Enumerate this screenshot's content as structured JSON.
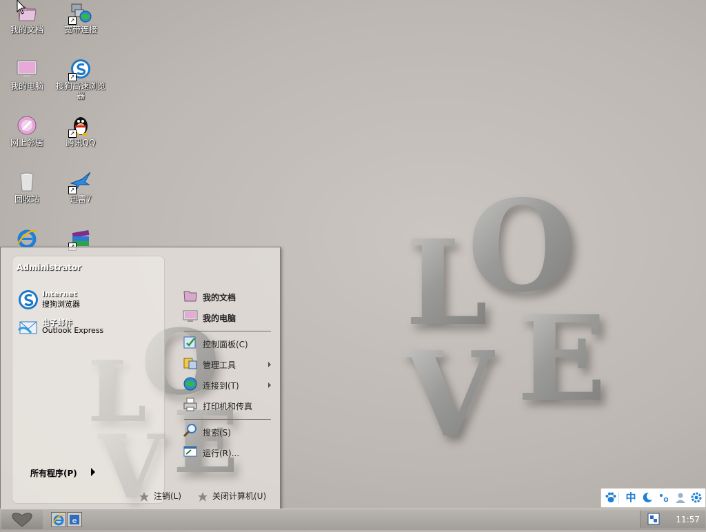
{
  "wallpaper": {
    "art": "love-sculpture",
    "letters": [
      "L",
      "O",
      "V",
      "E"
    ]
  },
  "desktop_icons": [
    {
      "label": "我的文档",
      "icon": "my-documents-icon",
      "shortcut": false
    },
    {
      "label": "宽带连接",
      "icon": "broadband-connection-icon",
      "shortcut": true
    },
    {
      "label": "我的电脑",
      "icon": "my-computer-icon",
      "shortcut": false
    },
    {
      "label": "搜狗高速浏览器",
      "icon": "sogou-browser-icon",
      "shortcut": true
    },
    {
      "label": "网上邻居",
      "icon": "network-places-icon",
      "shortcut": false
    },
    {
      "label": "腾讯QQ",
      "icon": "qq-penguin-icon",
      "shortcut": true
    },
    {
      "label": "回收站",
      "icon": "recycle-bin-icon",
      "shortcut": false
    },
    {
      "label": "迅雷7",
      "icon": "xunlei-bird-icon",
      "shortcut": true
    },
    {
      "label": "",
      "icon": "internet-explorer-icon",
      "shortcut": false
    },
    {
      "label": "",
      "icon": "winrar-books-icon",
      "shortcut": true
    }
  ],
  "start_menu": {
    "user_name": "Administrator",
    "pinned": [
      {
        "title": "Internet",
        "subtitle": "搜狗浏览器",
        "icon": "sogou-browser-icon"
      },
      {
        "title": "电子邮件",
        "subtitle": "Outlook Express",
        "icon": "outlook-express-icon"
      }
    ],
    "all_programs": "所有程序(P)",
    "right_items": [
      {
        "label": "我的文档",
        "icon": "folder-icon",
        "bold": true
      },
      {
        "label": "我的电脑",
        "icon": "computer-icon",
        "bold": true
      },
      {
        "label": "控制面板(C)",
        "icon": "control-panel-icon",
        "bold": false
      },
      {
        "label": "管理工具",
        "icon": "admin-tools-icon",
        "bold": false,
        "submenu": true
      },
      {
        "label": "连接到(T)",
        "icon": "globe-connect-icon",
        "bold": false,
        "submenu": true
      },
      {
        "label": "打印机和传真",
        "icon": "printer-icon",
        "bold": false
      },
      {
        "label": "搜索(S)",
        "icon": "search-icon",
        "bold": false
      },
      {
        "label": "运行(R)...",
        "icon": "run-icon",
        "bold": false
      }
    ],
    "logoff": "注销(L)",
    "shutdown": "关闭计算机(U)"
  },
  "taskbar": {
    "quick_launch": [
      "internet-explorer-icon",
      "outlook-icon"
    ],
    "tray_icon": "network-tray-icon",
    "clock": "11:57"
  },
  "ime": {
    "mode": "中",
    "icons": [
      "paw-icon",
      "chinese-mode-icon",
      "moon-icon",
      "punctuation-icon",
      "user-icon",
      "gear-icon"
    ]
  },
  "colors": {
    "ime_blue": "#1e7fd6",
    "taskbar": "#a9a5a1",
    "desktop": "#c3beb9"
  }
}
